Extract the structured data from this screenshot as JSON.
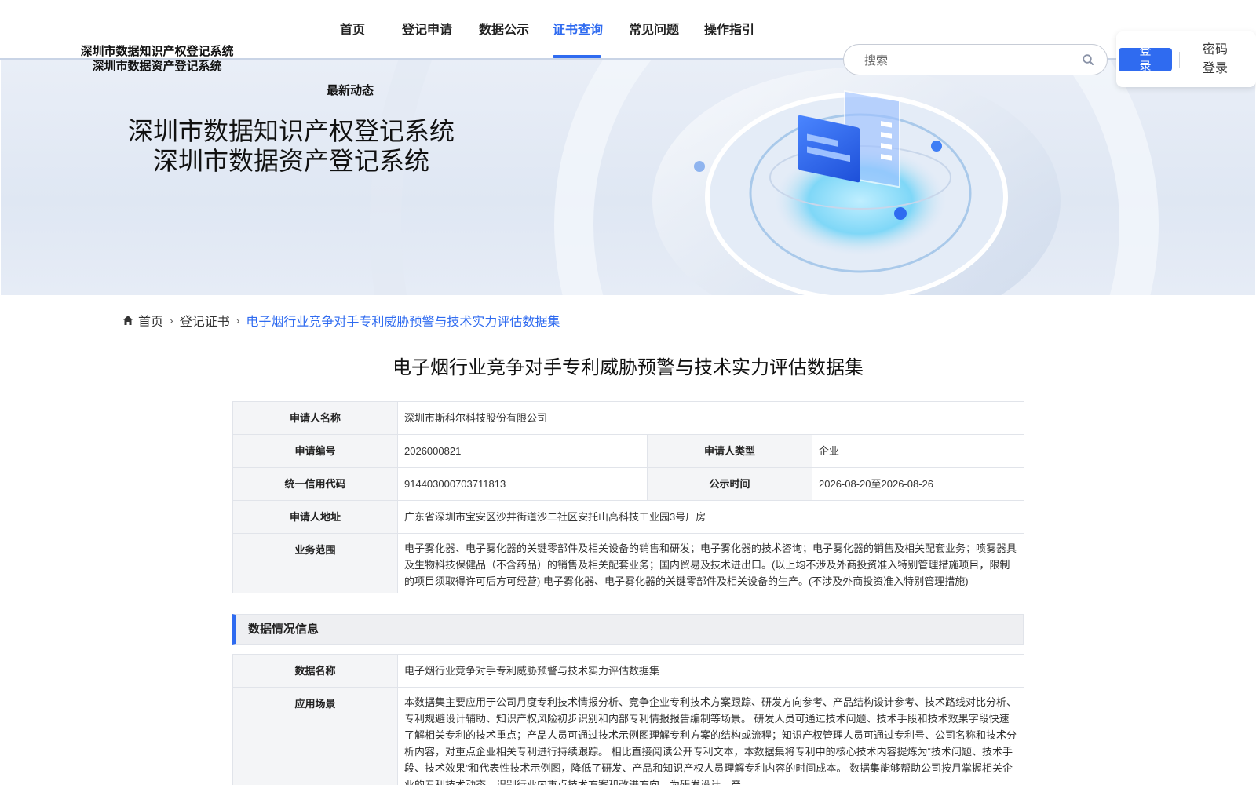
{
  "logo": {
    "line1": "深圳市数据知识产权登记系统",
    "line2": "深圳市数据资产登记系统"
  },
  "nav": {
    "home": "首页",
    "apply": "登记申请",
    "public": "数据公示",
    "cert": "证书查询",
    "faq": "常见问题",
    "guide": "操作指引",
    "latest": "最新动态",
    "active": "证书查询"
  },
  "search": {
    "placeholder": "搜索",
    "value": ""
  },
  "login": {
    "button": "登录",
    "password_login": "密码登录"
  },
  "banner": {
    "title_line1": "深圳市数据知识产权登记系统",
    "title_line2": "深圳市数据资产登记系统"
  },
  "breadcrumb": {
    "home": "首页",
    "level2": "登记证书",
    "current": "电子烟行业竞争对手专利威胁预警与技术实力评估数据集"
  },
  "page_title": "电子烟行业竞争对手专利威胁预警与技术实力评估数据集",
  "applicant": {
    "name_label": "申请人名称",
    "name": "深圳市斯科尔科技股份有限公司",
    "no_label": "申请编号",
    "no": "2026000821",
    "type_label": "申请人类型",
    "type": "企业",
    "credit_label": "统一信用代码",
    "credit": "914403000703711813",
    "time_label": "公示时间",
    "time": "2026-08-20至2026-08-26",
    "address_label": "申请人地址",
    "address": "广东省深圳市宝安区沙井街道沙二社区安托山高科技工业园3号厂房",
    "scope_label": "业务范围",
    "scope": "电子雾化器、电子雾化器的关键零部件及相关设备的销售和研发；电子雾化器的技术咨询；电子雾化器的销售及相关配套业务；喷雾器具及生物科技保健品（不含药品）的销售及相关配套业务；国内贸易及技术进出口。(以上均不涉及外商投资准入特别管理措施项目，限制的项目须取得许可后方可经营) 电子雾化器、电子雾化器的关键零部件及相关设备的生产。(不涉及外商投资准入特别管理措施)"
  },
  "data_section": {
    "heading": "数据情况信息",
    "name_label": "数据名称",
    "name": "电子烟行业竞争对手专利威胁预警与技术实力评估数据集",
    "scene_label": "应用场景",
    "scene": "本数据集主要应用于公司月度专利技术情报分析、竞争企业专利技术方案跟踪、研发方向参考、产品结构设计参考、技术路线对比分析、专利规避设计辅助、知识产权风险初步识别和内部专利情报报告编制等场景。 研发人员可通过技术问题、技术手段和技术效果字段快速了解相关专利的技术重点；产品人员可通过技术示例图理解专利方案的结构或流程；知识产权管理人员可通过专利号、公司名称和技术分析内容，对重点企业相关专利进行持续跟踪。 相比直接阅读公开专利文本，本数据集将专利中的核心技术内容提炼为“技术问题、技术手段、技术效果”和代表性技术示例图，降低了研发、产品和知识产权人员理解专利内容的时间成本。 数据集能够帮助公司按月掌握相关企业的专利技术动态，识别行业内重点技术方案和改进方向，为研发设计、产"
  }
}
